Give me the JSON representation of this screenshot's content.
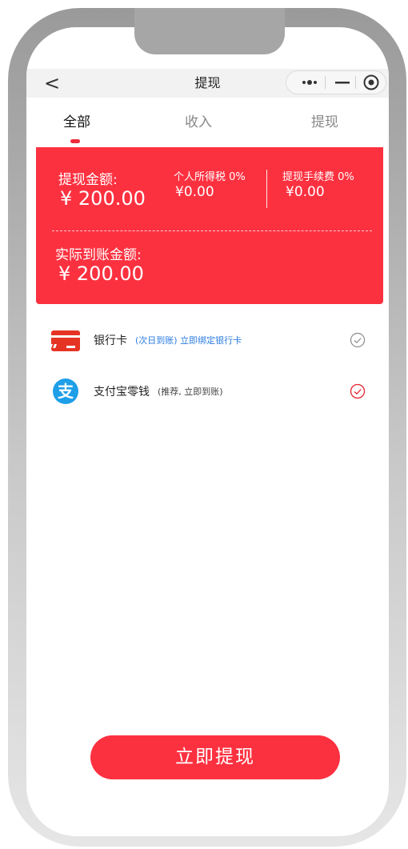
{
  "navbar": {
    "back_symbol": "<",
    "title": "提现"
  },
  "tabs": [
    {
      "label": "全部",
      "active": true
    },
    {
      "label": "收入",
      "active": false
    },
    {
      "label": "提现",
      "active": false
    }
  ],
  "summary": {
    "withdraw_label": "提现金额:",
    "withdraw_amount": "¥ 200.00",
    "tax_label": "个人所得税 0%",
    "tax_amount": "¥0.00",
    "fee_label": "提现手续费 0%",
    "fee_amount": "¥0.00",
    "actual_label": "实际到账金额:",
    "actual_amount": "¥ 200.00"
  },
  "options": [
    {
      "name": "银行卡",
      "note": "(次日到账) 立即绑定银行卡",
      "icon": "bank-card-icon",
      "selected": false
    },
    {
      "name": "支付宝零钱",
      "note": "(推荐, 立即到账)",
      "icon": "alipay-icon",
      "selected": true
    }
  ],
  "submit_button": "立即提现",
  "colors": {
    "accent": "#fc3140",
    "link": "#2b7de1",
    "alipay": "#1e9fe8"
  }
}
